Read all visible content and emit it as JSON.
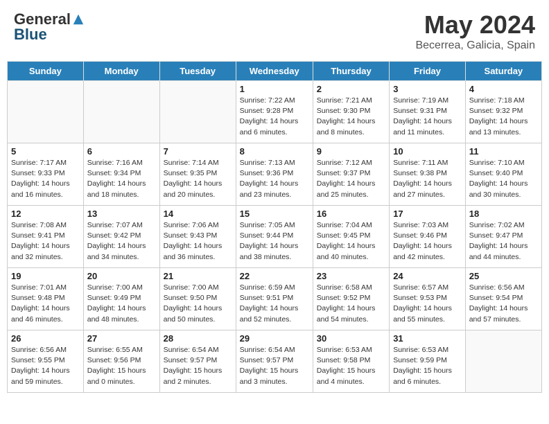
{
  "header": {
    "logo_general": "General",
    "logo_blue": "Blue",
    "month_year": "May 2024",
    "location": "Becerrea, Galicia, Spain"
  },
  "weekdays": [
    "Sunday",
    "Monday",
    "Tuesday",
    "Wednesday",
    "Thursday",
    "Friday",
    "Saturday"
  ],
  "weeks": [
    [
      {
        "day": "",
        "info": ""
      },
      {
        "day": "",
        "info": ""
      },
      {
        "day": "",
        "info": ""
      },
      {
        "day": "1",
        "info": "Sunrise: 7:22 AM\nSunset: 9:28 PM\nDaylight: 14 hours\nand 6 minutes."
      },
      {
        "day": "2",
        "info": "Sunrise: 7:21 AM\nSunset: 9:30 PM\nDaylight: 14 hours\nand 8 minutes."
      },
      {
        "day": "3",
        "info": "Sunrise: 7:19 AM\nSunset: 9:31 PM\nDaylight: 14 hours\nand 11 minutes."
      },
      {
        "day": "4",
        "info": "Sunrise: 7:18 AM\nSunset: 9:32 PM\nDaylight: 14 hours\nand 13 minutes."
      }
    ],
    [
      {
        "day": "5",
        "info": "Sunrise: 7:17 AM\nSunset: 9:33 PM\nDaylight: 14 hours\nand 16 minutes."
      },
      {
        "day": "6",
        "info": "Sunrise: 7:16 AM\nSunset: 9:34 PM\nDaylight: 14 hours\nand 18 minutes."
      },
      {
        "day": "7",
        "info": "Sunrise: 7:14 AM\nSunset: 9:35 PM\nDaylight: 14 hours\nand 20 minutes."
      },
      {
        "day": "8",
        "info": "Sunrise: 7:13 AM\nSunset: 9:36 PM\nDaylight: 14 hours\nand 23 minutes."
      },
      {
        "day": "9",
        "info": "Sunrise: 7:12 AM\nSunset: 9:37 PM\nDaylight: 14 hours\nand 25 minutes."
      },
      {
        "day": "10",
        "info": "Sunrise: 7:11 AM\nSunset: 9:38 PM\nDaylight: 14 hours\nand 27 minutes."
      },
      {
        "day": "11",
        "info": "Sunrise: 7:10 AM\nSunset: 9:40 PM\nDaylight: 14 hours\nand 30 minutes."
      }
    ],
    [
      {
        "day": "12",
        "info": "Sunrise: 7:08 AM\nSunset: 9:41 PM\nDaylight: 14 hours\nand 32 minutes."
      },
      {
        "day": "13",
        "info": "Sunrise: 7:07 AM\nSunset: 9:42 PM\nDaylight: 14 hours\nand 34 minutes."
      },
      {
        "day": "14",
        "info": "Sunrise: 7:06 AM\nSunset: 9:43 PM\nDaylight: 14 hours\nand 36 minutes."
      },
      {
        "day": "15",
        "info": "Sunrise: 7:05 AM\nSunset: 9:44 PM\nDaylight: 14 hours\nand 38 minutes."
      },
      {
        "day": "16",
        "info": "Sunrise: 7:04 AM\nSunset: 9:45 PM\nDaylight: 14 hours\nand 40 minutes."
      },
      {
        "day": "17",
        "info": "Sunrise: 7:03 AM\nSunset: 9:46 PM\nDaylight: 14 hours\nand 42 minutes."
      },
      {
        "day": "18",
        "info": "Sunrise: 7:02 AM\nSunset: 9:47 PM\nDaylight: 14 hours\nand 44 minutes."
      }
    ],
    [
      {
        "day": "19",
        "info": "Sunrise: 7:01 AM\nSunset: 9:48 PM\nDaylight: 14 hours\nand 46 minutes."
      },
      {
        "day": "20",
        "info": "Sunrise: 7:00 AM\nSunset: 9:49 PM\nDaylight: 14 hours\nand 48 minutes."
      },
      {
        "day": "21",
        "info": "Sunrise: 7:00 AM\nSunset: 9:50 PM\nDaylight: 14 hours\nand 50 minutes."
      },
      {
        "day": "22",
        "info": "Sunrise: 6:59 AM\nSunset: 9:51 PM\nDaylight: 14 hours\nand 52 minutes."
      },
      {
        "day": "23",
        "info": "Sunrise: 6:58 AM\nSunset: 9:52 PM\nDaylight: 14 hours\nand 54 minutes."
      },
      {
        "day": "24",
        "info": "Sunrise: 6:57 AM\nSunset: 9:53 PM\nDaylight: 14 hours\nand 55 minutes."
      },
      {
        "day": "25",
        "info": "Sunrise: 6:56 AM\nSunset: 9:54 PM\nDaylight: 14 hours\nand 57 minutes."
      }
    ],
    [
      {
        "day": "26",
        "info": "Sunrise: 6:56 AM\nSunset: 9:55 PM\nDaylight: 14 hours\nand 59 minutes."
      },
      {
        "day": "27",
        "info": "Sunrise: 6:55 AM\nSunset: 9:56 PM\nDaylight: 15 hours\nand 0 minutes."
      },
      {
        "day": "28",
        "info": "Sunrise: 6:54 AM\nSunset: 9:57 PM\nDaylight: 15 hours\nand 2 minutes."
      },
      {
        "day": "29",
        "info": "Sunrise: 6:54 AM\nSunset: 9:57 PM\nDaylight: 15 hours\nand 3 minutes."
      },
      {
        "day": "30",
        "info": "Sunrise: 6:53 AM\nSunset: 9:58 PM\nDaylight: 15 hours\nand 4 minutes."
      },
      {
        "day": "31",
        "info": "Sunrise: 6:53 AM\nSunset: 9:59 PM\nDaylight: 15 hours\nand 6 minutes."
      },
      {
        "day": "",
        "info": ""
      }
    ]
  ]
}
